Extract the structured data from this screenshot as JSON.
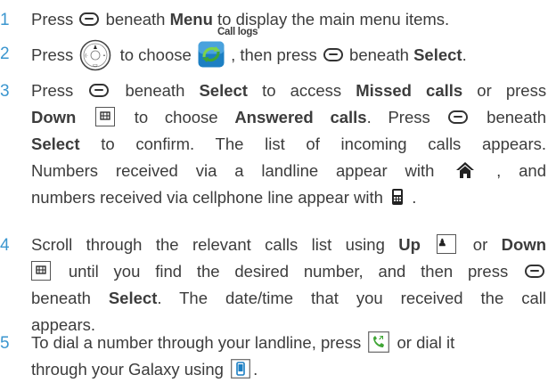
{
  "steps": [
    {
      "number": "1",
      "parts": [
        "Press",
        "beneath",
        "Menu",
        "to display the main menu items."
      ]
    },
    {
      "number": "2",
      "parts": [
        "Press",
        "to choose",
        ", then press",
        "beneath",
        "Select",
        "."
      ],
      "app_label": "Call logs"
    },
    {
      "number": "3",
      "lines": [
        [
          "Press",
          "beneath",
          "Select",
          "to access",
          "Missed calls",
          "or press"
        ],
        [
          "Down",
          "to choose",
          "Answered calls",
          ". Press",
          "beneath"
        ],
        [
          "Select",
          "to confirm. The list of incoming calls appears."
        ],
        [
          "Numbers received via a landline appear with",
          ", and"
        ],
        [
          "numbers received via cellphone line appear with",
          "."
        ]
      ]
    },
    {
      "number": "4",
      "lines": [
        [
          "Scroll through the relevant calls list using",
          "Up",
          "or",
          "Down"
        ],
        [
          "until you find the desired number, and then press"
        ],
        [
          "beneath",
          "Select",
          ". The date/time that you received the call"
        ],
        [
          "appears."
        ]
      ]
    },
    {
      "number": "5",
      "lines": [
        [
          "To dial a number through your landline, press",
          "or dial it"
        ],
        [
          "through your Galaxy using",
          "."
        ]
      ]
    }
  ],
  "icons": {
    "softkey": "softkey-icon",
    "nav": "navigation-ring-icon",
    "app": "call-logs-app-icon",
    "up_key": "up-key-2-icon",
    "down_key": "down-key-8-icon",
    "home": "landline-home-icon",
    "cell": "cellphone-icon",
    "talk": "green-talk-key-icon",
    "galaxy": "galaxy-phone-key-icon"
  },
  "colors": {
    "step_number": "#3b96cf",
    "app_green": "#3fa535",
    "app_blue": "#1c7fc3"
  }
}
